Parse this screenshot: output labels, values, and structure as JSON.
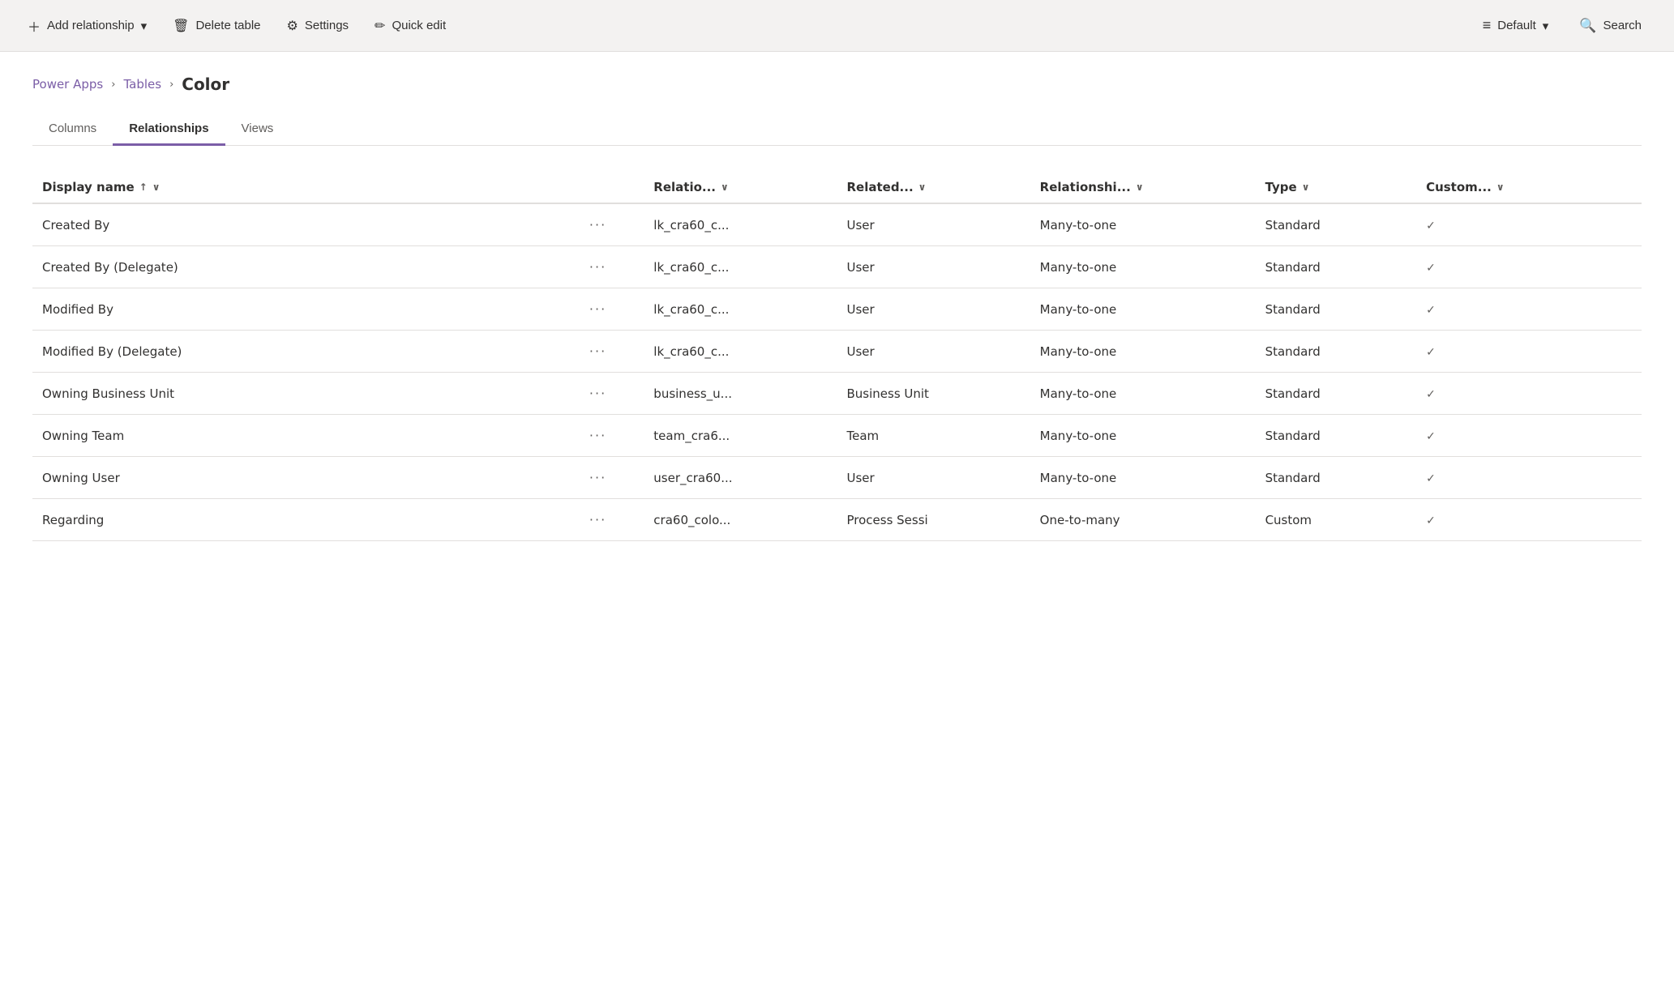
{
  "toolbar": {
    "add_relationship_label": "Add relationship",
    "add_dropdown_icon": "▾",
    "delete_table_label": "Delete table",
    "settings_label": "Settings",
    "quick_edit_label": "Quick edit",
    "default_label": "Default",
    "default_dropdown_icon": "▾",
    "search_label": "Search"
  },
  "breadcrumb": {
    "power_apps": "Power Apps",
    "sep1": "›",
    "tables": "Tables",
    "sep2": "›",
    "current": "Color"
  },
  "tabs": [
    {
      "id": "columns",
      "label": "Columns",
      "active": false
    },
    {
      "id": "relationships",
      "label": "Relationships",
      "active": true
    },
    {
      "id": "views",
      "label": "Views",
      "active": false
    }
  ],
  "table": {
    "columns": [
      {
        "id": "display_name",
        "label": "Display name",
        "has_sort": true,
        "has_filter": true
      },
      {
        "id": "actions",
        "label": "",
        "has_sort": false,
        "has_filter": false
      },
      {
        "id": "relationship_name",
        "label": "Relatio...",
        "has_sort": false,
        "has_filter": true
      },
      {
        "id": "related",
        "label": "Related...",
        "has_sort": false,
        "has_filter": true
      },
      {
        "id": "relationship_type",
        "label": "Relationshi...",
        "has_sort": false,
        "has_filter": true
      },
      {
        "id": "type",
        "label": "Type",
        "has_sort": false,
        "has_filter": true
      },
      {
        "id": "customizable",
        "label": "Custom...",
        "has_sort": false,
        "has_filter": true
      }
    ],
    "rows": [
      {
        "display_name": "Created By",
        "relationship_name": "lk_cra60_c...",
        "related": "User",
        "relationship_type": "Many-to-one",
        "type": "Standard",
        "customizable": true
      },
      {
        "display_name": "Created By (Delegate)",
        "relationship_name": "lk_cra60_c...",
        "related": "User",
        "relationship_type": "Many-to-one",
        "type": "Standard",
        "customizable": true
      },
      {
        "display_name": "Modified By",
        "relationship_name": "lk_cra60_c...",
        "related": "User",
        "relationship_type": "Many-to-one",
        "type": "Standard",
        "customizable": true
      },
      {
        "display_name": "Modified By (Delegate)",
        "relationship_name": "lk_cra60_c...",
        "related": "User",
        "relationship_type": "Many-to-one",
        "type": "Standard",
        "customizable": true
      },
      {
        "display_name": "Owning Business Unit",
        "relationship_name": "business_u...",
        "related": "Business Unit",
        "relationship_type": "Many-to-one",
        "type": "Standard",
        "customizable": true
      },
      {
        "display_name": "Owning Team",
        "relationship_name": "team_cra6...",
        "related": "Team",
        "relationship_type": "Many-to-one",
        "type": "Standard",
        "customizable": true
      },
      {
        "display_name": "Owning User",
        "relationship_name": "user_cra60...",
        "related": "User",
        "relationship_type": "Many-to-one",
        "type": "Standard",
        "customizable": true
      },
      {
        "display_name": "Regarding",
        "relationship_name": "cra60_colo...",
        "related": "Process Sessi",
        "relationship_type": "One-to-many",
        "type": "Custom",
        "customizable": true
      }
    ]
  }
}
